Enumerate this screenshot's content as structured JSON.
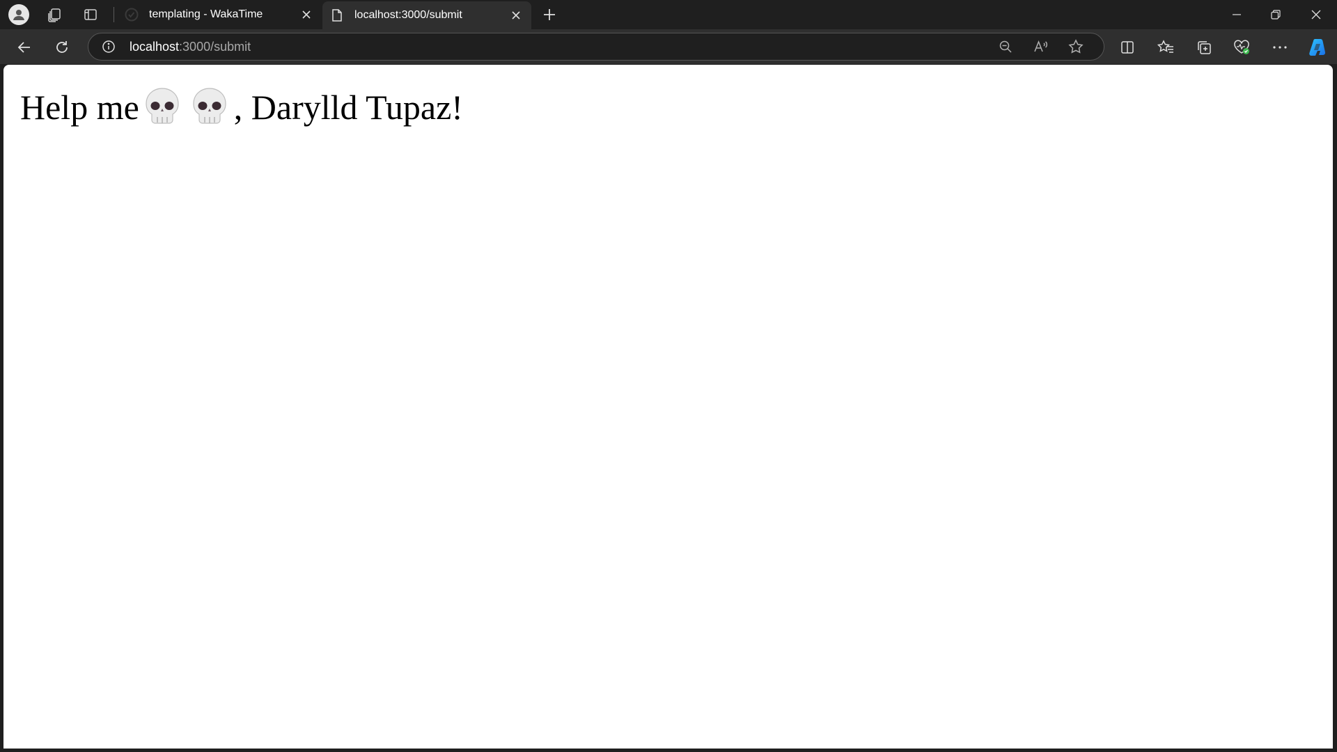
{
  "browser": {
    "tabs": [
      {
        "title": "templating - WakaTime",
        "active": false,
        "favicon": "wakatime-icon"
      },
      {
        "title": "localhost:3000/submit",
        "active": true,
        "favicon": "page-icon"
      }
    ],
    "address": {
      "host": "localhost",
      "path": ":3000/submit"
    },
    "colors": {
      "chrome_dark": "#1f1f1f",
      "toolbar": "#2f2f2f",
      "page_bg": "#ffffff"
    }
  },
  "page": {
    "heading_prefix": "Help me",
    "heading_suffix": ", Darylld Tupaz!",
    "emoji": [
      "skull-icon",
      "skull-icon"
    ]
  }
}
